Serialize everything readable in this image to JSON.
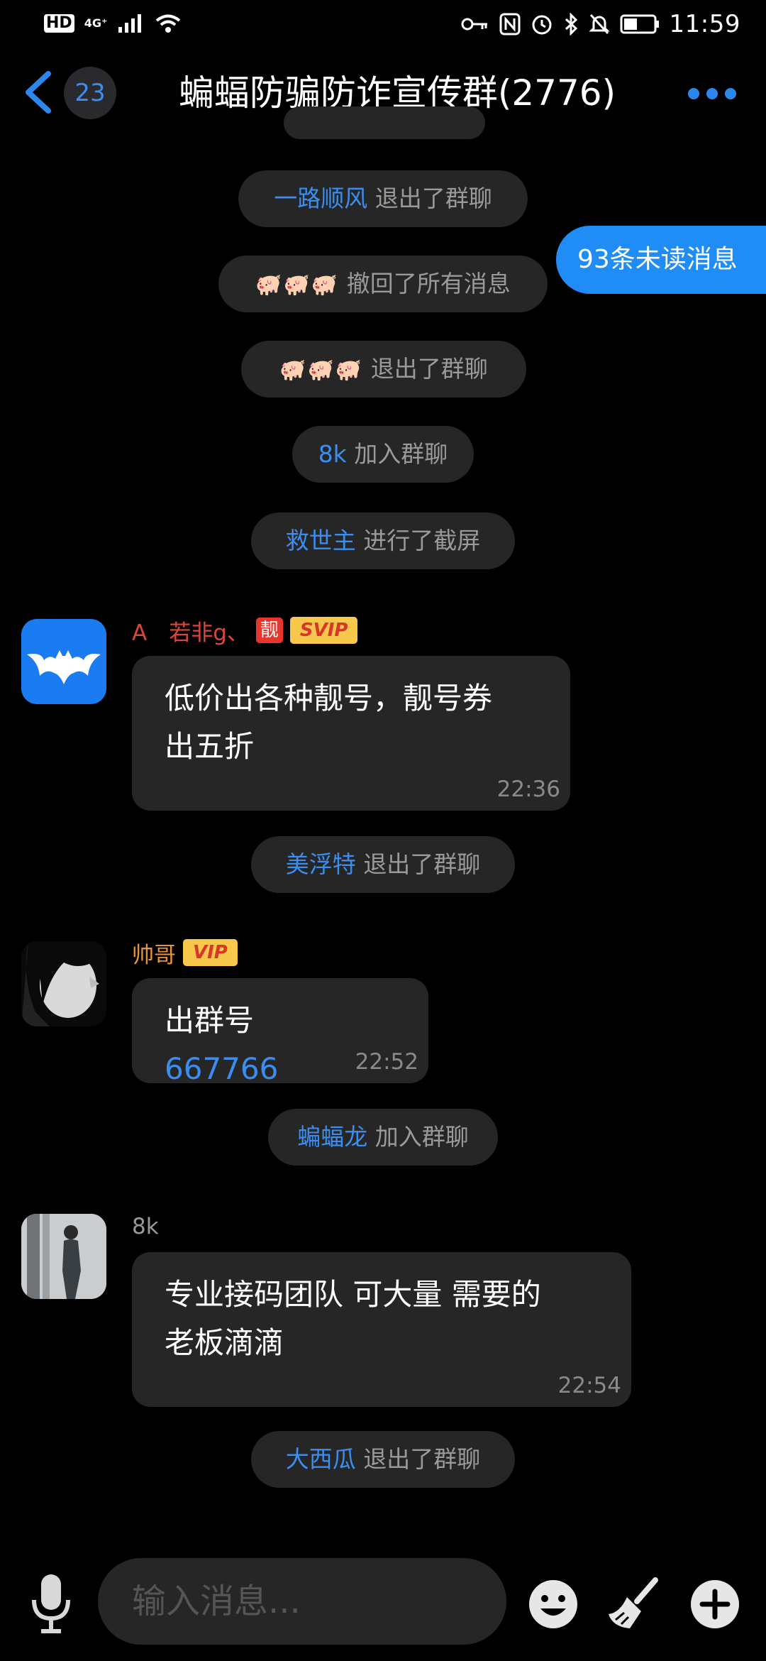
{
  "status_bar": {
    "hd": "HD",
    "network": "4G⁺",
    "time": "11:59",
    "icons": [
      "signal-icon",
      "wifi-icon",
      "key-icon",
      "nfc-icon",
      "alarm-icon",
      "bluetooth-icon",
      "mute-icon",
      "battery-icon"
    ]
  },
  "header": {
    "back_icon": "chevron-left-icon",
    "unread_count": "23",
    "title": "蝙蝠防骗防诈宣传群(2776)",
    "more_icon": "more-dots-icon"
  },
  "unread_pill": "93条未读消息",
  "system_messages": [
    {
      "who": "一路顺风",
      "action": "退出了群聊"
    },
    {
      "who": "🐖🐖🐖",
      "action": "撤回了所有消息"
    },
    {
      "who": "🐖🐖🐖",
      "action": "退出了群聊"
    },
    {
      "who": "8k",
      "action": "加入群聊"
    },
    {
      "who": "救世主",
      "action": "进行了截屏"
    },
    {
      "who": "美浮特",
      "action": "退出了群聊"
    },
    {
      "who": "蝙蝠龙",
      "action": "加入群聊"
    },
    {
      "who": "大西瓜",
      "action": "退出了群聊"
    }
  ],
  "messages": [
    {
      "sender": "A　若非g、",
      "sender_color": "#d9463b",
      "badge_liang": "靓",
      "badge": "SVIP",
      "text": "低价出各种靓号，靓号券\n出五折",
      "time": "22:36",
      "avatar": "bat-logo-avatar"
    },
    {
      "sender": "帅哥",
      "sender_color": "#e8953a",
      "badge": "VIP",
      "text": "出群号",
      "number": "667766",
      "time": "22:52",
      "avatar": "portrait-avatar"
    },
    {
      "sender": "8k",
      "sender_color": "#9a9a9a",
      "text": "专业接码团队 可大量 需要的\n老板滴滴",
      "time": "22:54",
      "avatar": "photo-avatar"
    }
  ],
  "input_bar": {
    "placeholder": "输入消息...",
    "icons": [
      "microphone-icon",
      "emoji-icon",
      "broom-icon",
      "plus-icon"
    ]
  },
  "colors": {
    "accent": "#1f8df5",
    "link": "#3b8ef0",
    "bubble": "#262626",
    "background": "#000000"
  }
}
